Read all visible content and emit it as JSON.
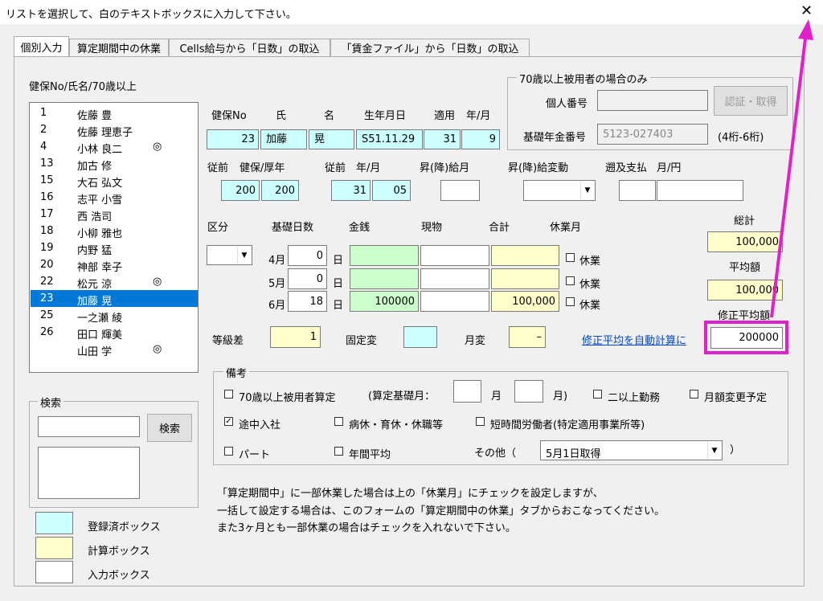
{
  "window": {
    "title": "リストを選択して、白のテキストボックスに入力して下さい。",
    "close": "✕"
  },
  "tabs": [
    "個別入力",
    "算定期間中の休業",
    "Cells給与から「日数」の取込",
    "「賃金ファイル」から「日数」の取込"
  ],
  "list": {
    "header": "健保No/氏名/70歳以上",
    "items": [
      {
        "no": "1",
        "name": "佐藤 豊",
        "mark": ""
      },
      {
        "no": "2",
        "name": "佐藤 理恵子",
        "mark": ""
      },
      {
        "no": "4",
        "name": "小林 良二",
        "mark": "◎"
      },
      {
        "no": "13",
        "name": "加古 修",
        "mark": ""
      },
      {
        "no": "15",
        "name": "大石 弘文",
        "mark": ""
      },
      {
        "no": "16",
        "name": "志平 小雪",
        "mark": ""
      },
      {
        "no": "17",
        "name": "西 浩司",
        "mark": ""
      },
      {
        "no": "18",
        "name": "小柳 雅也",
        "mark": ""
      },
      {
        "no": "19",
        "name": "内野 猛",
        "mark": ""
      },
      {
        "no": "20",
        "name": "神部 幸子",
        "mark": ""
      },
      {
        "no": "22",
        "name": "松元 涼",
        "mark": "◎"
      },
      {
        "no": "23",
        "name": "加藤 晃",
        "mark": ""
      },
      {
        "no": "25",
        "name": "一之瀬 綾",
        "mark": ""
      },
      {
        "no": "26",
        "name": "田口 輝美",
        "mark": ""
      },
      {
        "no": "",
        "name": "山田 学",
        "mark": "◎"
      }
    ],
    "selected_index": 11
  },
  "search": {
    "title": "検索",
    "button": "検索",
    "value": ""
  },
  "legend": {
    "registered": "登録済ボックス",
    "calc": "計算ボックス",
    "input": "入力ボックス"
  },
  "header_labels": {
    "no": "健保No",
    "shi": "氏",
    "mei": "名",
    "birth": "生年月日",
    "apply": "適用",
    "ym": "年/月"
  },
  "person": {
    "no": "23",
    "shi": "加藤",
    "mei": "晃",
    "birth": "S51.11.29",
    "apply_y": "31",
    "apply_m": "9"
  },
  "over70": {
    "title": "70歳以上被用者の場合のみ",
    "personal_no_label": "個人番号",
    "personal_no": "",
    "auth_button": "認証・取得",
    "pension_label": "基礎年金番号",
    "pension_no": "5123-027403",
    "pension_hint": "(4桁-6桁)"
  },
  "prev": {
    "label_zenzen": "従前",
    "label_kenpo": "健保/厚年",
    "kenpo": "200",
    "kounen": "200",
    "label_zenzen2": "従前",
    "label_ym": "年/月",
    "y": "31",
    "m": "05",
    "label_shoukyu": "昇(降)給月",
    "shoukyu": "",
    "label_shoukyu_hendo": "昇(降)給変動",
    "hendo": "",
    "label_sokyu": "遡及支払",
    "label_sokyu_ym": "月/円",
    "sokyu_m": "",
    "sokyu_yen": ""
  },
  "grid": {
    "label_kubun": "区分",
    "kubun": "",
    "label_days": "基礎日数",
    "label_money": "金銭",
    "label_goods": "現物",
    "label_total": "合計",
    "label_kyugyo": "休業月",
    "day_unit": "日",
    "kyugyo_label": "休業",
    "rows": [
      {
        "month": "4月",
        "days": "0",
        "money": "",
        "goods": "",
        "total": ""
      },
      {
        "month": "5月",
        "days": "0",
        "money": "",
        "goods": "",
        "total": ""
      },
      {
        "month": "6月",
        "days": "18",
        "money": "100000",
        "goods": "",
        "total": "100,000"
      }
    ],
    "sum_label": "総計",
    "sum": "100,000",
    "avg_label": "平均額",
    "avg": "100,000",
    "mod_avg_label": "修正平均額",
    "mod_avg": "200000"
  },
  "grade": {
    "label": "等級差",
    "value": "1",
    "fixed_label": "固定変",
    "fixed": "",
    "monthly_label": "月変",
    "monthly": "–"
  },
  "auto_link": "修正平均を自動計算に",
  "remarks": {
    "title": "備考",
    "over70": "70歳以上被用者算定",
    "base_month_label": "(算定基礎月：",
    "month_unit": "月",
    "month_unit_close": "月)",
    "multi": "二以上勤務",
    "change_plan": "月額変更予定",
    "midway": "途中入社",
    "sick": "病休・育休・休職等",
    "short": "短時間労働者(特定適用事業所等)",
    "part": "パート",
    "annual": "年間平均",
    "other_label": "その他（",
    "other_value": "5月1日取得",
    "other_close": "）"
  },
  "notes": [
    "「算定期間中」に一部休業した場合は上の「休業月」にチェックを設定しますが、",
    "一括して設定する場合は、このフォームの「算定期間中の休業」タブからおこなってください。",
    "また3ヶ月とも一部休業の場合はチェックを入れないで下さい。"
  ],
  "colors": {
    "highlight": "#e020c8",
    "selected": "#0078d7",
    "link": "#0044cc",
    "cyan": "#ccffff",
    "yellow": "#ffffcc",
    "green": "#ccffcc"
  }
}
